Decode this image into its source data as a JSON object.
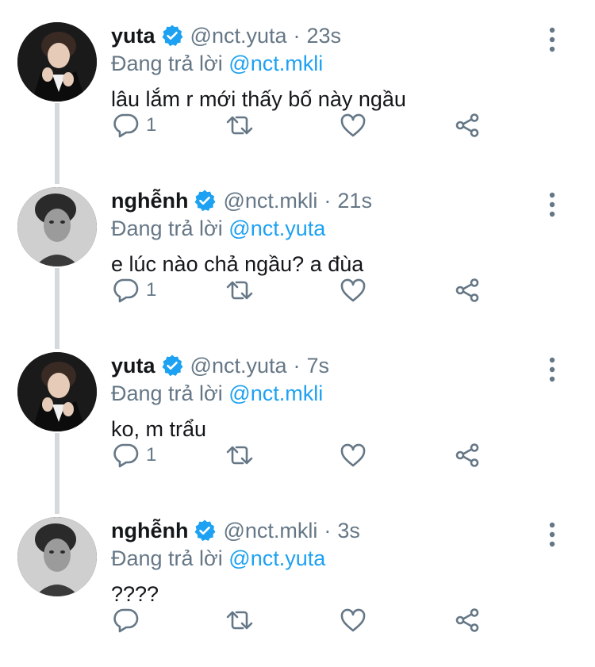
{
  "reply_prefix": "Đang trả lời",
  "colors": {
    "accent": "#1da1f2",
    "muted": "#657786",
    "thread_line": "#d4d9dd"
  },
  "tweets": [
    {
      "name": "yuta",
      "handle": "@nct.yuta",
      "time": "23s",
      "reply_to": "@nct.mkli",
      "text": "lâu lắm r mới thấy bố này ngầu",
      "reply_count": "1",
      "avatar_icon": "yuta-avatar"
    },
    {
      "name": "nghễnh",
      "handle": "@nct.mkli",
      "time": "21s",
      "reply_to": "@nct.yuta",
      "text": "e lúc nào chả ngầu? a đùa",
      "reply_count": "1",
      "avatar_icon": "mkli-avatar"
    },
    {
      "name": "yuta",
      "handle": "@nct.yuta",
      "time": "7s",
      "reply_to": "@nct.mkli",
      "text": "ko, m trẩu",
      "reply_count": "1",
      "avatar_icon": "yuta-avatar"
    },
    {
      "name": "nghễnh",
      "handle": "@nct.mkli",
      "time": "3s",
      "reply_to": "@nct.yuta",
      "text": "????",
      "reply_count": "",
      "avatar_icon": "mkli-avatar"
    }
  ]
}
